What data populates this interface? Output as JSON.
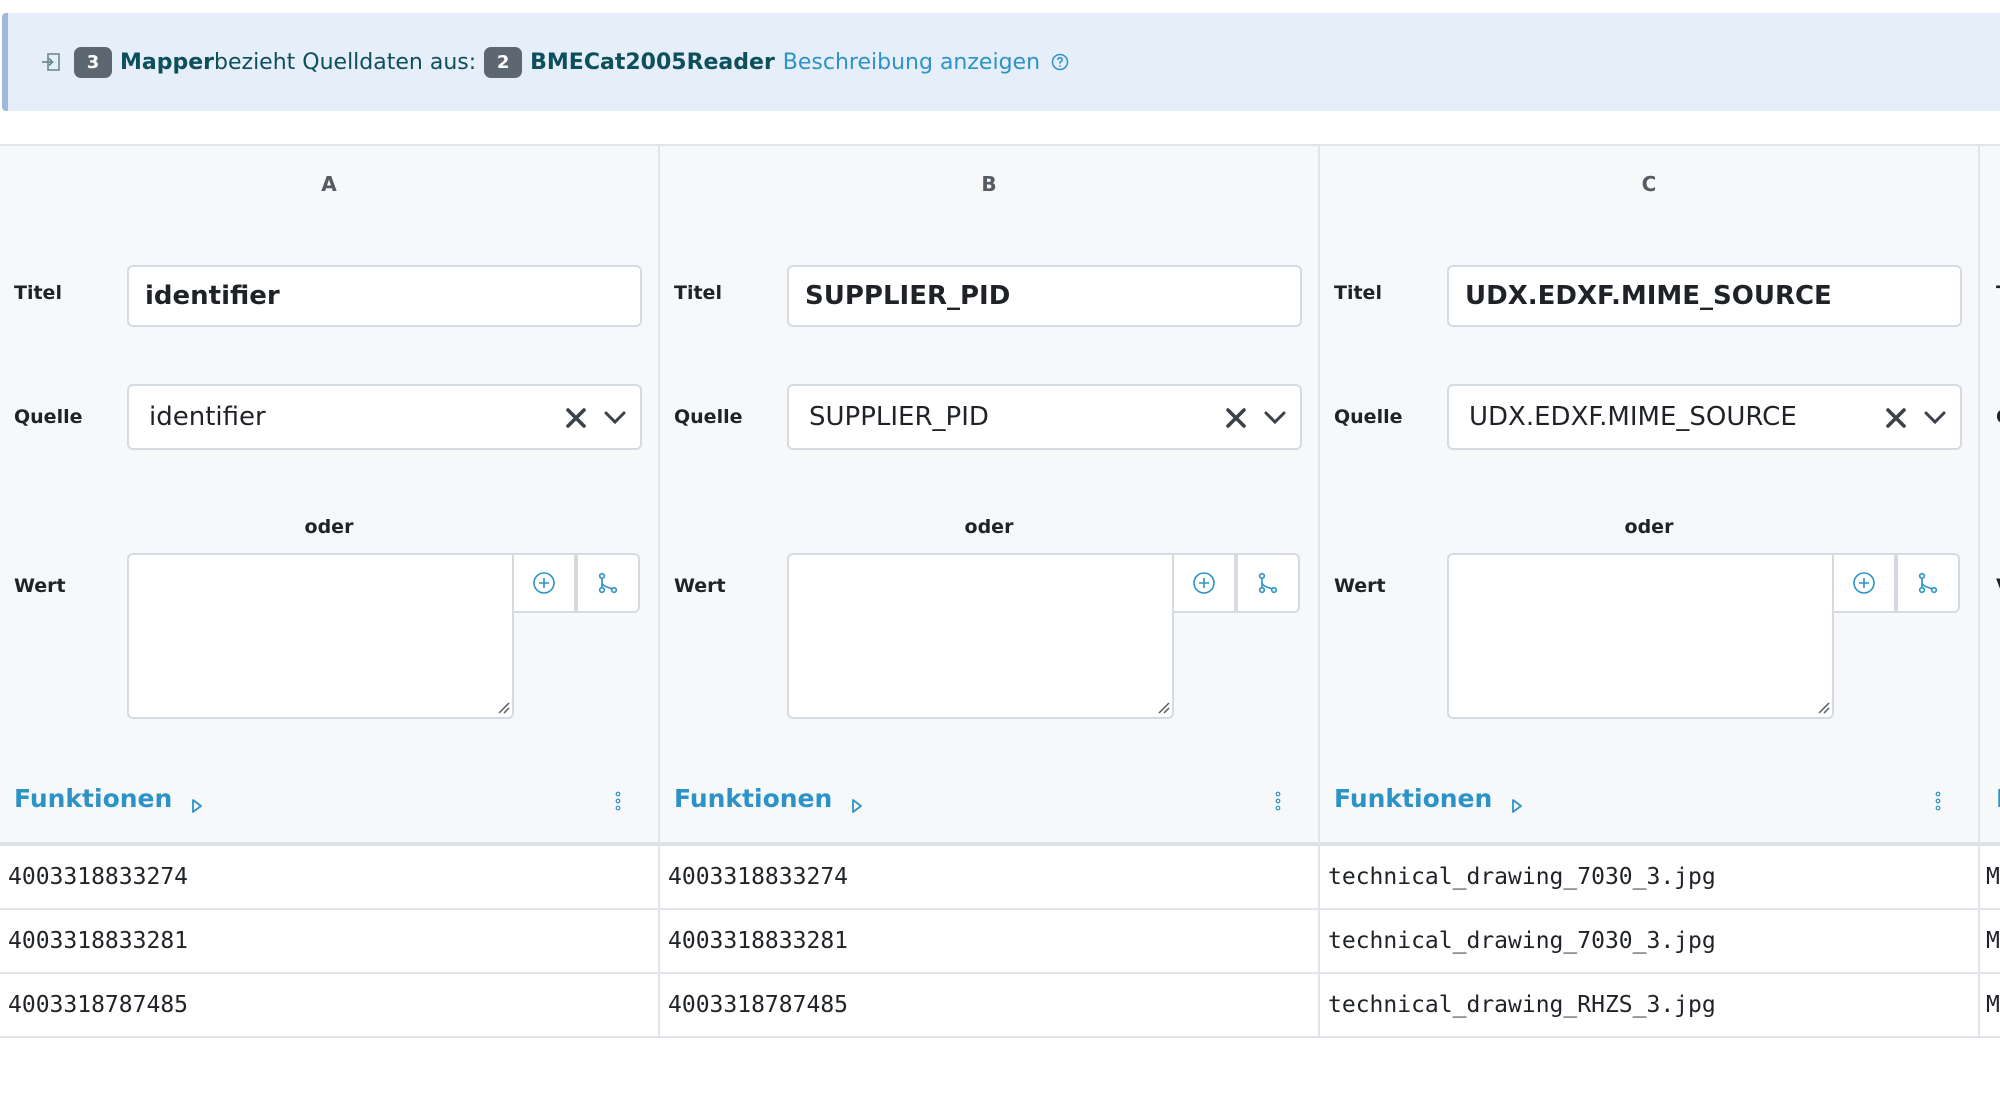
{
  "banner": {
    "mapper_count": "3",
    "mapper_label": "Mapper",
    "source_text": "bezieht Quelldaten aus:",
    "reader_count": "2",
    "reader_name": "BMECat2005Reader",
    "description_link": "Beschreibung anzeigen"
  },
  "labels": {
    "titel": "Titel",
    "quelle": "Quelle",
    "oder": "oder",
    "wert": "Wert",
    "funktionen": "Funktionen"
  },
  "columns": [
    {
      "letter": "A",
      "title": "identifier",
      "source": "identifier",
      "value": ""
    },
    {
      "letter": "B",
      "title": "SUPPLIER_PID",
      "source": "SUPPLIER_PID",
      "value": ""
    },
    {
      "letter": "C",
      "title": "UDX.EDXF.MIME_SOURCE",
      "source": "UDX.EDXF.MIME_SOURCE",
      "value": ""
    }
  ],
  "partial_column": {
    "titel_fragment": "T",
    "quelle_fragment": "C",
    "wert_fragment": "V",
    "funktionen_fragment": "F"
  },
  "rows": [
    [
      "4003318833274",
      "4003318833274",
      "technical_drawing_7030_3.jpg",
      "M"
    ],
    [
      "4003318833281",
      "4003318833281",
      "technical_drawing_7030_3.jpg",
      "M"
    ],
    [
      "4003318787485",
      "4003318787485",
      "technical_drawing_RHZS_3.jpg",
      "M"
    ]
  ],
  "colors": {
    "banner_bg": "#e6eefa",
    "link": "#2d93c6",
    "badge": "#5d6772",
    "column_bg": "#f6f8fa"
  }
}
